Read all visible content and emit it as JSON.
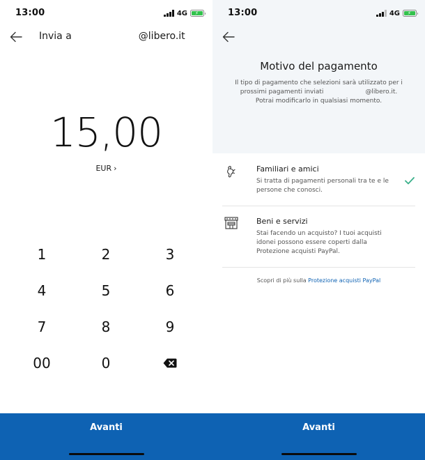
{
  "status_bar": {
    "time": "13:00",
    "network": "4G"
  },
  "send_screen": {
    "header_prefix": "Invia a",
    "header_email": "@libero.it",
    "amount": "15,00",
    "currency": "EUR",
    "keypad": [
      "1",
      "2",
      "3",
      "4",
      "5",
      "6",
      "7",
      "8",
      "9",
      "00",
      "0"
    ],
    "backspace_icon": "backspace-icon",
    "cta_label": "Avanti"
  },
  "reason_screen": {
    "title": "Motivo del pagamento",
    "description_line1": "Il tipo di pagamento che selezioni sarà utilizzato per i",
    "description_line2_prefix": "prossimi pagamenti inviati",
    "description_line2_email": "@libero.it.",
    "description_line3": "Potrai modificarlo in qualsiasi momento.",
    "options": [
      {
        "icon": "friends-icon",
        "title": "Familiari e amici",
        "description": "Si tratta di pagamenti personali tra te e le persone che conosci.",
        "selected": true
      },
      {
        "icon": "store-icon",
        "title": "Beni e servizi",
        "description": "Stai facendo un acquisto? I tuoi acquisti idonei possono essere coperti dalla Protezione acquisti PayPal.",
        "selected": false
      }
    ],
    "footnote_prefix": "Scopri di più sulla",
    "footnote_link": "Protezione acquisti PayPal",
    "cta_label": "Avanti"
  },
  "colors": {
    "primary_blue": "#0e62b3",
    "check_green": "#3ab08a",
    "battery_green": "#33c24d",
    "header_bg": "#f3f6f9"
  }
}
